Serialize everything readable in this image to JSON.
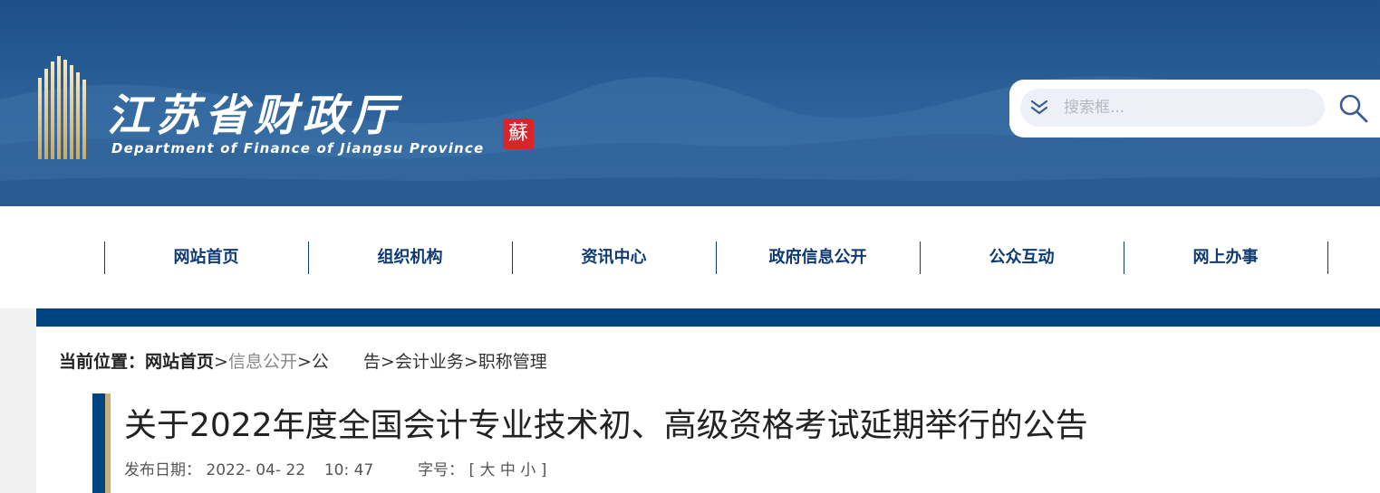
{
  "header": {
    "title_cn": "江苏省财政厅",
    "title_en": "Department of Finance of Jiangsu Province",
    "seal_char": "蘇",
    "search": {
      "placeholder": "搜索框..."
    }
  },
  "nav": {
    "items": [
      "网站首页",
      "组织机构",
      "资讯中心",
      "政府信息公开",
      "公众互动",
      "网上办事"
    ]
  },
  "breadcrumb": {
    "prefix": "当前位置：",
    "items": [
      "网站首页",
      "信息公开",
      "公　　告",
      "会计业务",
      "职称管理"
    ],
    "separator": ">"
  },
  "article": {
    "title": "关于2022年度全国会计专业技术初、高级资格考试延期举行的公告",
    "date_label": "发布日期：",
    "date": "2022- 04- 22",
    "time": "10: 47",
    "font_size_label": "字号：",
    "font_sizes": [
      "大",
      "中",
      "小"
    ],
    "bracket_open": "[",
    "bracket_close": "]"
  },
  "colors": {
    "brand_blue": "#004381",
    "nav_text": "#0d3a73",
    "seal_red": "#d6262c",
    "accent_gold": "#c8b278"
  },
  "icons": [
    "chevron-down-icon",
    "search-icon",
    "building-logo-icon"
  ]
}
